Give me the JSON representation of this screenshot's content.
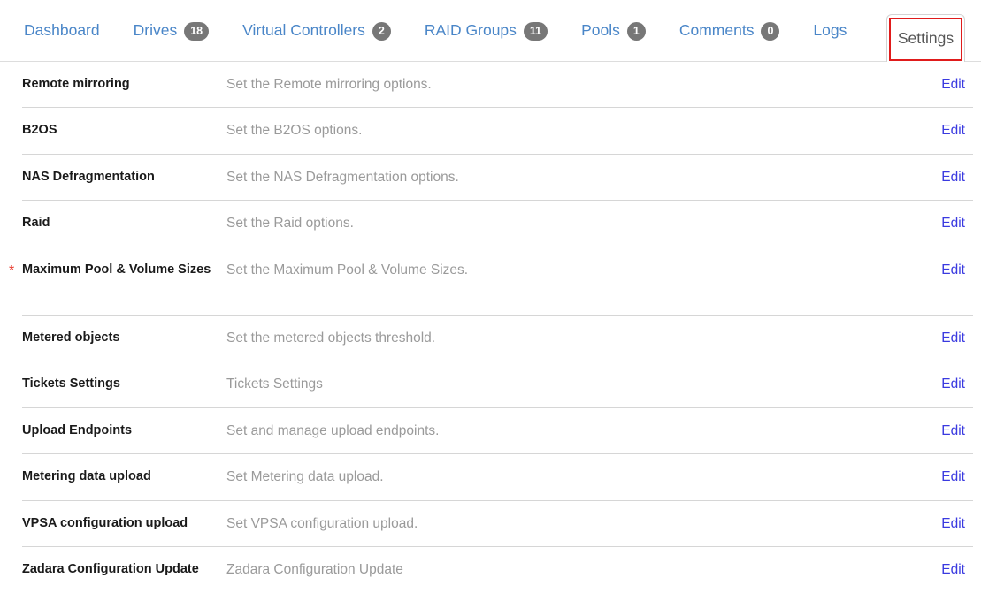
{
  "tabs": [
    {
      "label": "Dashboard",
      "badge": null,
      "active": false
    },
    {
      "label": "Drives",
      "badge": "18",
      "active": false
    },
    {
      "label": "Virtual Controllers",
      "badge": "2",
      "active": false
    },
    {
      "label": "RAID Groups",
      "badge": "11",
      "active": false
    },
    {
      "label": "Pools",
      "badge": "1",
      "active": false
    },
    {
      "label": "Comments",
      "badge": "0",
      "active": false
    },
    {
      "label": "Logs",
      "badge": null,
      "active": false
    }
  ],
  "active_tab": {
    "label": "Settings",
    "highlighted": true
  },
  "colors": {
    "tab_link": "#4a86c8",
    "badge_bg": "#777777",
    "edit_link": "#3a3ae0",
    "highlight_border": "#e01b1b",
    "asterisk": "#e8392c",
    "description": "#9a9a9a"
  },
  "settings": {
    "edit_label": "Edit",
    "required_marker": "*",
    "rows": [
      {
        "name": "Remote mirroring",
        "description": "Set the Remote mirroring options.",
        "action": "Edit",
        "required": false
      },
      {
        "name": "B2OS",
        "description": "Set the B2OS options.",
        "action": "Edit",
        "required": false
      },
      {
        "name": "NAS Defragmentation",
        "description": "Set the NAS Defragmentation options.",
        "action": "Edit",
        "required": false
      },
      {
        "name": "Raid",
        "description": "Set the Raid options.",
        "action": "Edit",
        "required": false
      },
      {
        "name": "Maximum Pool & Volume Sizes",
        "description": "Set the Maximum Pool & Volume Sizes.",
        "action": "Edit",
        "required": true
      },
      {
        "name": "Metered objects",
        "description": "Set the metered objects threshold.",
        "action": "Edit",
        "required": false
      },
      {
        "name": "Tickets Settings",
        "description": "Tickets Settings",
        "action": "Edit",
        "required": false
      },
      {
        "name": "Upload Endpoints",
        "description": "Set and manage upload endpoints.",
        "action": "Edit",
        "required": false
      },
      {
        "name": "Metering data upload",
        "description": "Set Metering data upload.",
        "action": "Edit",
        "required": false
      },
      {
        "name": "VPSA configuration upload",
        "description": "Set VPSA configuration upload.",
        "action": "Edit",
        "required": false
      },
      {
        "name": "Zadara Configuration Update",
        "description": "Zadara Configuration Update",
        "action": "Edit",
        "required": false
      }
    ]
  }
}
